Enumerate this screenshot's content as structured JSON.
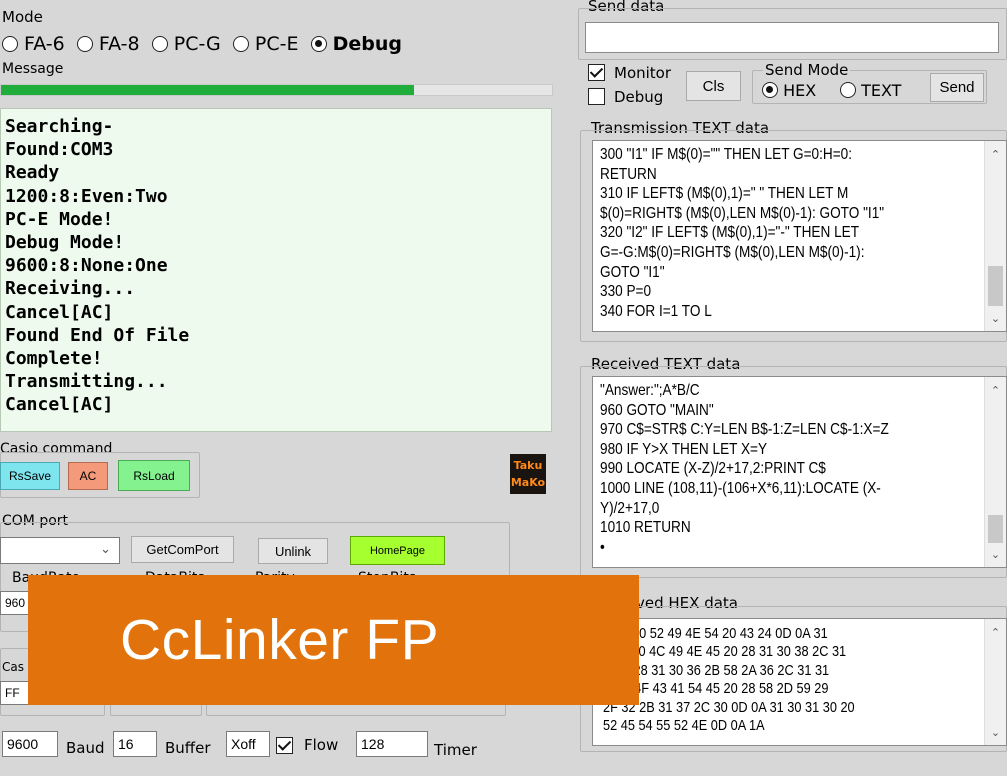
{
  "mode": {
    "label": "Mode",
    "options": [
      "FA-6",
      "FA-8",
      "PC-G",
      "PC-E",
      "Debug"
    ],
    "selected": "Debug"
  },
  "message": {
    "label": "Message",
    "progress": 0.75,
    "lines": "Searching-\nFound:COM3\nReady\n1200:8:Even:Two\nPC-E Mode!\nDebug Mode!\n9600:8:None:One\nReceiving...\nCancel[AC]\nFound End Of File\nComplete!\nTransmitting...\nCancel[AC]"
  },
  "casio": {
    "label": "Casio command",
    "rs_save": "RsSave",
    "ac": "AC",
    "rs_load": "RsLoad"
  },
  "logo": {
    "line1": "Taku",
    "line2": "MaKo"
  },
  "com": {
    "label": "COM port",
    "get_com_port": "GetComPort",
    "unlink": "Unlink",
    "home_page": "HomePage",
    "baud_rate_label": "BaudRate",
    "data_bits_label": "DataBits",
    "parity_label": "Parity",
    "stop_bits_label": "StopBits",
    "baud_value": "960",
    "casio_label": "Cas",
    "ff_value": "FF"
  },
  "bottom": {
    "baud_value": "9600",
    "baud_label": "Baud",
    "buffer_value": "16",
    "buffer_label": "Buffer",
    "xoff_value": "Xoff",
    "flow_label": "Flow",
    "timer_value": "128",
    "timer_label": "Timer"
  },
  "send": {
    "label": "Send data",
    "value": "",
    "monitor_label": "Monitor",
    "debug_label": "Debug",
    "cls": "Cls",
    "send_mode_label": "Send Mode",
    "hex": "HEX",
    "text": "TEXT",
    "send_button": "Send"
  },
  "transmission": {
    "label": "Transmission TEXT data",
    "text": "300 \"I1\" IF M$(0)=\"\" THEN LET G=0:H=0:\nRETURN\n310 IF LEFT$ (M$(0),1)=\" \" THEN LET M\n$(0)=RIGHT$ (M$(0),LEN M$(0)-1): GOTO \"I1\"\n320 \"I2\" IF LEFT$ (M$(0),1)=\"-\" THEN LET\nG=-G:M$(0)=RIGHT$ (M$(0),LEN M$(0)-1):\nGOTO \"I1\"\n330 P=0\n340 FOR I=1 TO L"
  },
  "received": {
    "label": "Received TEXT data",
    "text": "\"Answer:\";A*B/C\n960 GOTO \"MAIN\"\n970 C$=STR$ C:Y=LEN B$-1:Z=LEN C$-1:X=Z\n980 IF Y>X THEN LET X=Y\n990 LOCATE (X-Z)/2+17,2:PRINT C$\n1000 LINE (108,11)-(106+X*6,11):LOCATE (X-\nY)/2+17,0\n1010 RETURN\n•"
  },
  "hex": {
    "label": "ved HEX data",
    "text": "2 3A 50 52 49 4E 54 20 43 24 0D 0A 31\n0 30 20 4C 49 4E 45 20 28 31 30 38 2C 31\n9 2D 28 31 30 36 2B 58 2A 36 2C 31 31\nA 4C 4F 43 41 54 45 20 28 58 2D 59 29\n2F 32 2B 31 37 2C 30 0D 0A 31 30 31 30 20\n52 45 54 55 52 4E 0D 0A 1A"
  },
  "banner": {
    "title": "CcLinker FP"
  },
  "colors": {
    "banner": "#e2720c",
    "progress": "#1fae3c",
    "message_bg": "#eefaee",
    "rs_save": "#7ee5ef",
    "ac": "#f49a7a",
    "rs_load": "#84f28e",
    "home_page": "#a6ff2e"
  }
}
